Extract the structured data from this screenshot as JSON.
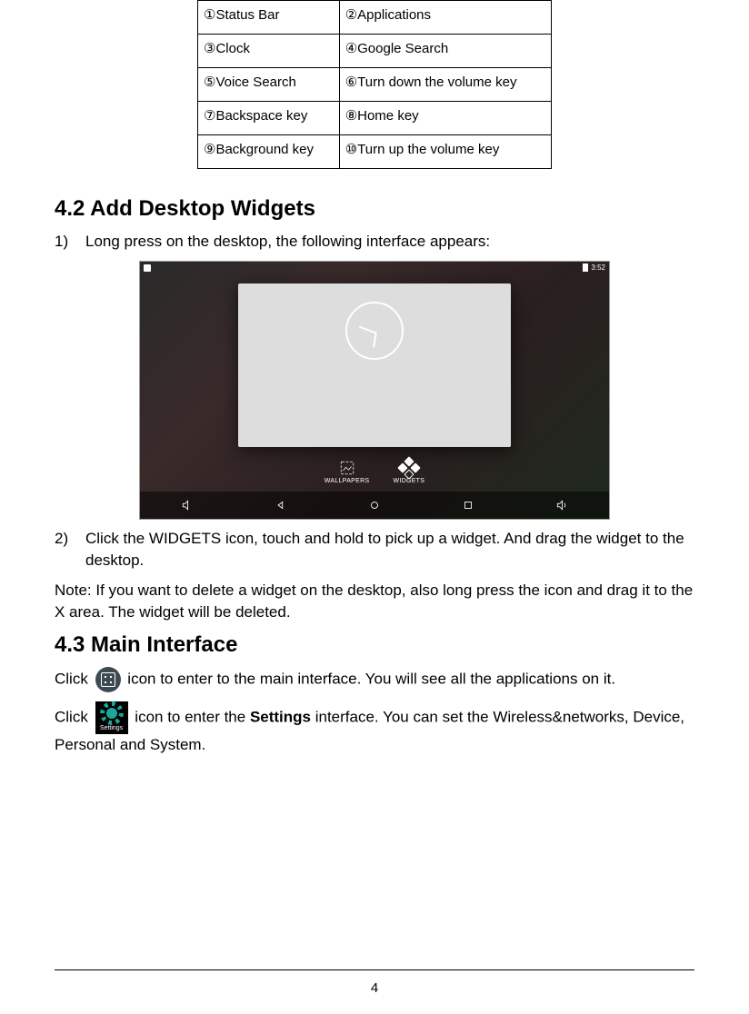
{
  "ref_table": [
    [
      "①Status Bar",
      "②Applications"
    ],
    [
      "③Clock",
      "④Google Search"
    ],
    [
      "⑤Voice Search",
      "⑥Turn down the volume key"
    ],
    [
      "⑦Backspace key",
      "⑧Home key"
    ],
    [
      "⑨Background key",
      "⑩Turn up the volume key"
    ]
  ],
  "section_4_2": {
    "heading": "4.2 Add Desktop Widgets",
    "step1_num": "1)",
    "step1": "Long press on the desktop, the following interface appears:",
    "screenshot": {
      "status_time": "3:52",
      "option_wallpapers": "WALLPAPERS",
      "option_widgets": "WIDGETS"
    },
    "step2_num": "2)",
    "step2": "Click the WIDGETS icon, touch and hold to pick up a widget. And drag the widget to the desktop.",
    "note": "Note: If you want to delete a widget on the desktop, also long press the icon and drag it to the X area. The widget will be deleted."
  },
  "section_4_3": {
    "heading": "4.3 Main Interface",
    "p1_a": "Click ",
    "p1_b": " icon to enter to the main interface. You will see all the applications on it.",
    "p2_a": "Click ",
    "p2_b": " icon to enter the ",
    "p2_bold": "Settings",
    "p2_c": " interface. You can set the Wireless&networks, Device, Personal and System.",
    "settings_label": "Settings"
  },
  "page_number": "4"
}
